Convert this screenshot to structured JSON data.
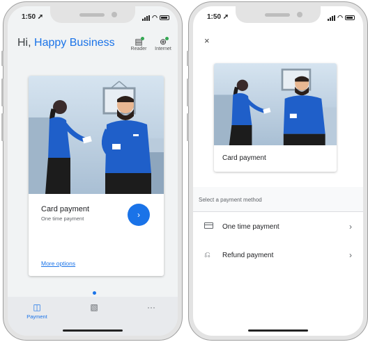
{
  "status": {
    "time": "1:50"
  },
  "left": {
    "greeting": {
      "prefix": "Hi,",
      "name": "Happy Business"
    },
    "header_icons": [
      {
        "label": "Reader",
        "icon": "reader-icon"
      },
      {
        "label": "Internet",
        "icon": "globe-icon"
      }
    ],
    "card": {
      "title": "Card payment",
      "subtitle": "One time payment",
      "more_options": "More options",
      "next_glyph": "›"
    },
    "tabs": [
      {
        "label": "Payment",
        "icon": "wallet-icon",
        "active": true
      },
      {
        "label": "",
        "icon": "receipt-icon",
        "active": false
      },
      {
        "label": "",
        "icon": "more-icon",
        "active": false
      }
    ]
  },
  "right": {
    "close_glyph": "×",
    "card_title": "Card payment",
    "section_label": "Select a payment method",
    "methods": [
      {
        "label": "One time payment",
        "icon": "credit-card-icon",
        "chevron": "›"
      },
      {
        "label": "Refund payment",
        "icon": "refund-icon",
        "chevron": "›"
      }
    ]
  },
  "colors": {
    "accent": "#1a73e8",
    "status_online": "#34a853"
  }
}
